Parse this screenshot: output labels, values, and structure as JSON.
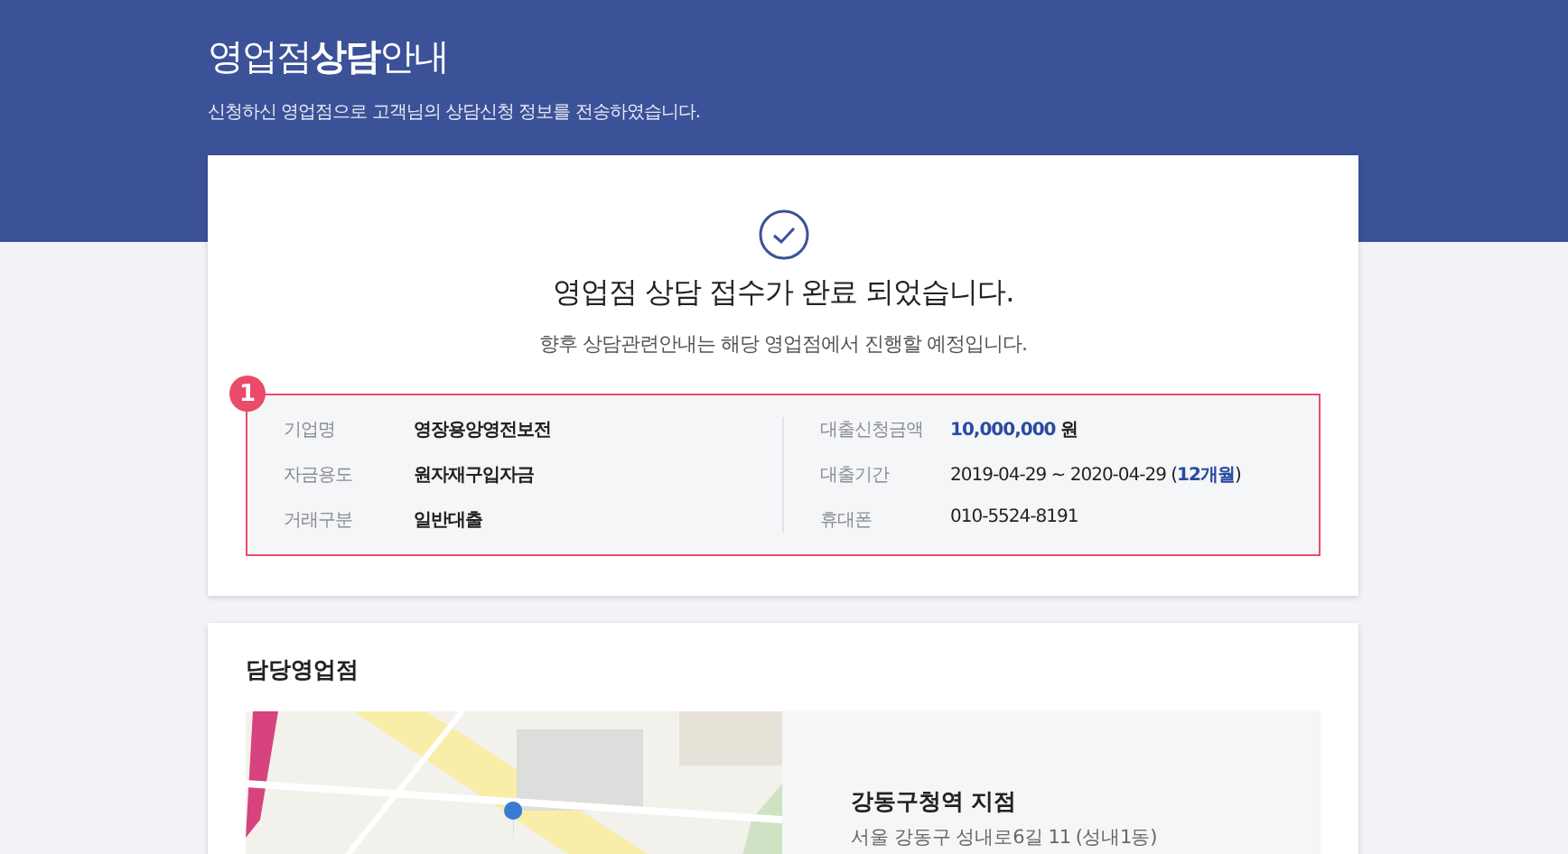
{
  "header": {
    "title": "영업점**상담**안내",
    "subtitle": "신청하신 영업점으로 고객님의 상담신청 정보를 전송하였습니다."
  },
  "result": {
    "title": "영업점 상담 접수가 완료 되었습니다.",
    "message": "향후 상담관련안내는 해당 영업점에서 진행할 예정입니다.",
    "step": "1",
    "columns": [
      [
        {
          "label": "기업명",
          "value": [
            {
              "text": "영장용앙영전보전",
              "accent": false
            }
          ],
          "bold": true
        },
        {
          "label": "자금용도",
          "value": [
            {
              "text": "원자재구입자금",
              "accent": false
            }
          ],
          "bold": true
        },
        {
          "label": "거래구분",
          "value": [
            {
              "text": "일반대출",
              "accent": false
            }
          ],
          "bold": true
        }
      ],
      [
        {
          "label": "대출신청금액",
          "value": [
            {
              "text": "10,000,000",
              "accent": true
            },
            {
              "text": " 원",
              "accent": false
            }
          ],
          "bold": true
        },
        {
          "label": "대출기간",
          "value": [
            {
              "text": "2019-04-29 ~ 2020-04-29 (",
              "accent": false
            },
            {
              "text": "12개월",
              "accent": true
            },
            {
              "text": ")",
              "accent": false
            }
          ],
          "bold": false
        },
        {
          "label": "휴대폰",
          "value": [
            {
              "text": "010-5524-8191",
              "accent": false
            }
          ],
          "bold": false
        }
      ]
    ]
  },
  "branch": {
    "heading": "담당영업점",
    "name": "강동구청역 지점",
    "address": "서울 강동구 성내로6길 11 (성내1동)"
  }
}
